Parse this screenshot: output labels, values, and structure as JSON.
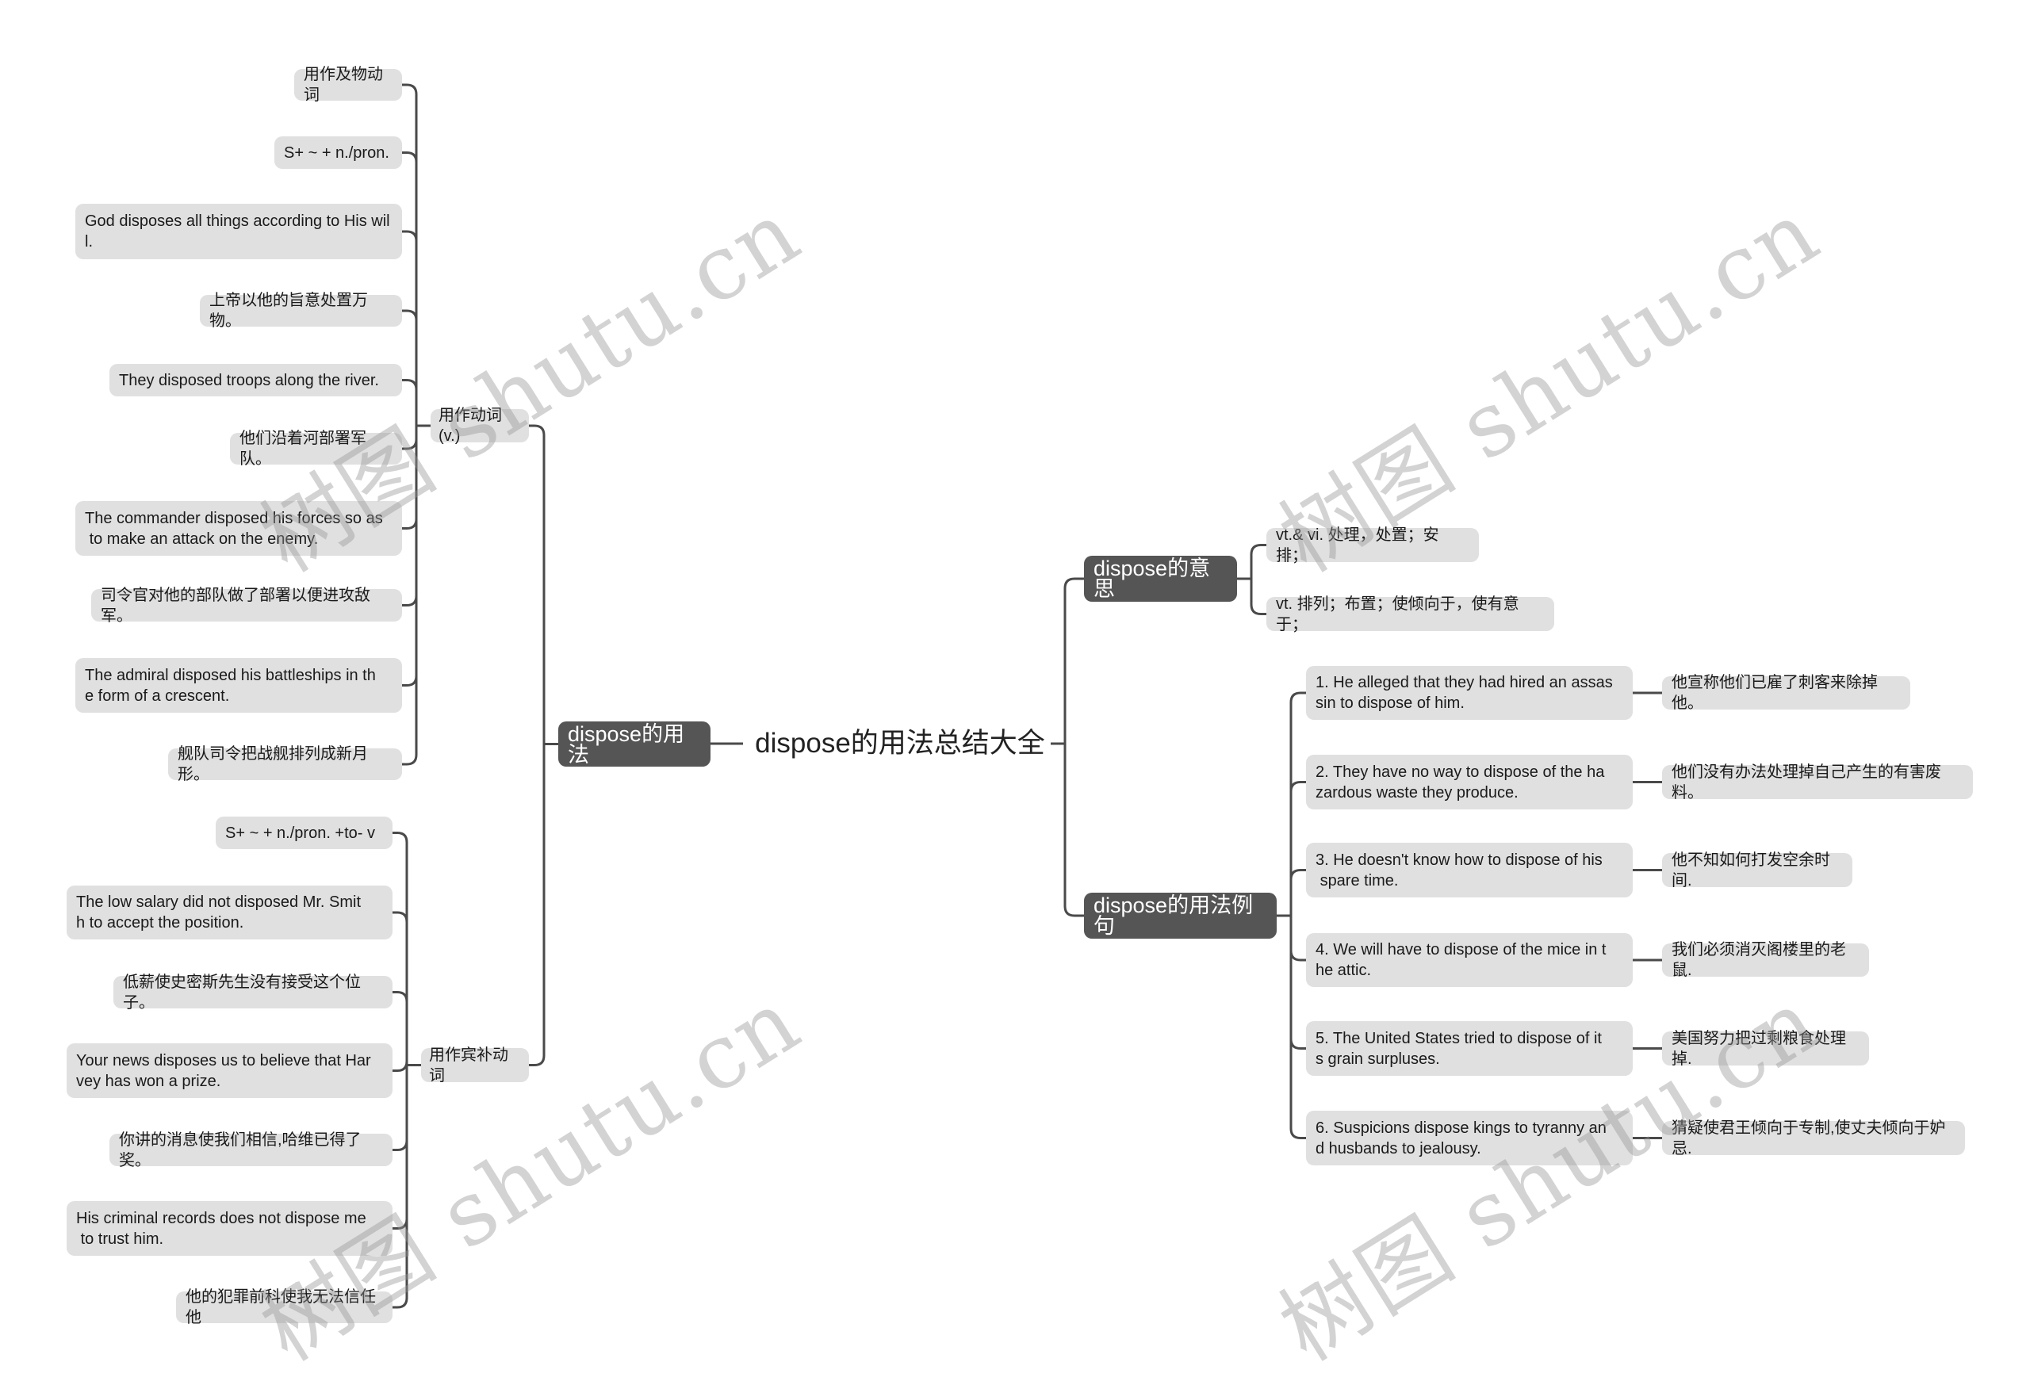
{
  "root": {
    "title": "dispose的用法总结大全"
  },
  "left": {
    "main": {
      "label": "dispose的用法"
    },
    "groups": [
      {
        "label": "用作动词(v.)",
        "items": [
          "用作及物动词",
          "S+ ~ + n./pron.",
          "God disposes all things according to His will.",
          "上帝以他的旨意处置万物。",
          "They disposed troops along the river.",
          "他们沿着河部署军队。",
          "The commander disposed his forces so as\n to make an attack on the enemy.",
          "司令官对他的部队做了部署以便进攻敌军。",
          "The admiral disposed his battleships in th\ne form of a crescent.",
          "舰队司令把战舰排列成新月形。"
        ]
      },
      {
        "label": "用作宾补动词",
        "items": [
          "S+ ~ + n./pron. +to- v",
          "The low salary did not disposed Mr. Smit\nh to accept the position.",
          "低薪使史密斯先生没有接受这个位子。",
          "Your news disposes us to believe that Har\nvey has won a prize.",
          "你讲的消息使我们相信,哈维已得了奖。",
          "His criminal records does not dispose me\n to trust him.",
          "他的犯罪前科使我无法信任他"
        ]
      }
    ]
  },
  "right": {
    "meaning": {
      "label": "dispose的意思",
      "items": [
        "vt.& vi. 处理，处置；安排；",
        "vt. 排列；布置；使倾向于，使有意于；"
      ]
    },
    "examples": {
      "label": "dispose的用法例句",
      "items": [
        {
          "en": "1. He alleged that they had hired an assas\nsin to dispose of him.",
          "zh": "他宣称他们已雇了刺客来除掉他。"
        },
        {
          "en": "2. They have no way to dispose of the ha\nzardous waste they produce.",
          "zh": "他们没有办法处理掉自己产生的有害废料。"
        },
        {
          "en": "3. He doesn't know how to dispose of his\n spare time.",
          "zh": "他不知如何打发空余时间."
        },
        {
          "en": "4. We will have to dispose of the mice in t\nhe attic.",
          "zh": "我们必须消灭阁楼里的老鼠."
        },
        {
          "en": "5. The United States tried to dispose of it\ns grain surpluses.",
          "zh": "美国努力把过剩粮食处理掉."
        },
        {
          "en": "6. Suspicions dispose kings to tyranny an\nd husbands to jealousy.",
          "zh": "猜疑使君王倾向于专制,使丈夫倾向于妒忌."
        }
      ]
    }
  },
  "watermark": {
    "text": "树图 shutu.cn"
  },
  "colors": {
    "main_node": "#555555",
    "leaf_node": "#e0e0e0",
    "line": "#4a4a4a",
    "watermark": "#c8c8c8"
  }
}
